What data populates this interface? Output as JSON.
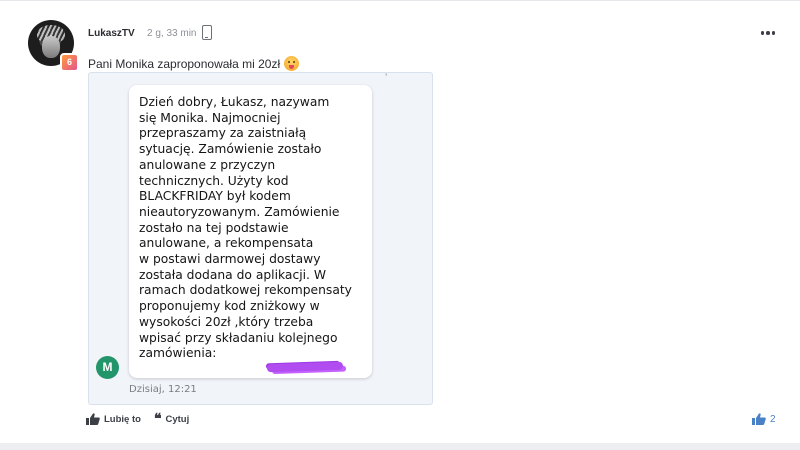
{
  "post": {
    "author": "LukaszTV",
    "time": "2 g, 33 min",
    "text": "Pani Monika zaproponowała mi 20zł",
    "rank_badge": "6",
    "emoji": "tongue-out-emoji"
  },
  "screenshot": {
    "top_glitch": "ʼ",
    "message": "Dzień dobry, Łukasz, nazywam\nsię Monika. Najmocniej\nprzepraszamy za zaistniałą\nsytuację. Zamówienie zostało\nanulowane z przyczyn\ntechnicznych. Użyty kod\nBLACKFRIDAY był kodem\nnieautoryzowanym. Zamówienie\nzostało na tej podstawie\nanulowane, a rekompensata\nw postawi darmowej dostawy\nzostała dodana do aplikacji. W\nramach dodatkowej rekompensaty\nproponujemy kod zniżkowy w\nwysokości 20zł ,który trzeba\nwpisać przy składaniu kolejnego\nzamówienia:",
    "sender_initial": "M",
    "timestamp": "Dzisiaj, 12:21",
    "redaction_color": "#b04cf0"
  },
  "actions": {
    "like_label": "Lubię to",
    "quote_label": "Cytuj",
    "like_count": "2"
  },
  "colors": {
    "like_accent": "#4a80c6",
    "sender_avatar": "#22956b"
  }
}
